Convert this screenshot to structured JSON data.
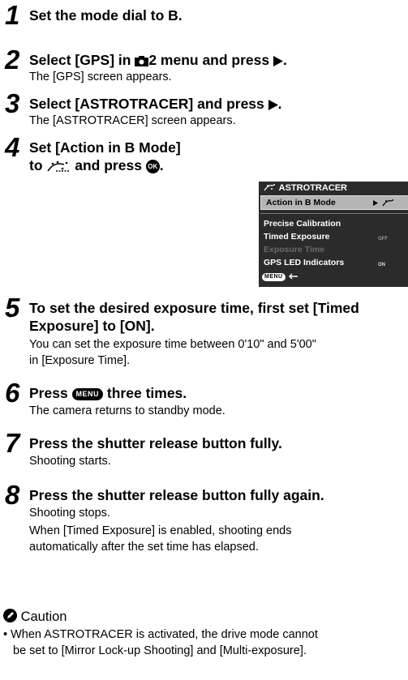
{
  "steps": [
    {
      "num": "1",
      "title": "Set the mode dial to B."
    },
    {
      "num": "2",
      "title_a": "Select [GPS] in ",
      "title_b": "2 menu and press ",
      "title_c": ".",
      "desc": "The [GPS] screen appears."
    },
    {
      "num": "3",
      "title_a": "Select [ASTROTRACER] and press ",
      "title_c": ".",
      "desc": "The [ASTROTRACER] screen appears."
    },
    {
      "num": "4",
      "line1": "Set [Action in B Mode]",
      "line2_a": "to ",
      "line2_b": " and press ",
      "line2_c": "."
    },
    {
      "num": "5",
      "line1": "To set the desired exposure time, first set [Timed",
      "line2": "Exposure] to [ON].",
      "desc1": "You can set the exposure time between 0'10\" and 5'00\"",
      "desc2": "in [Exposure Time]."
    },
    {
      "num": "6",
      "title_a": "Press ",
      "title_b": " three times.",
      "desc": "The camera returns to standby mode."
    },
    {
      "num": "7",
      "title": "Press the shutter release button fully.",
      "desc": "Shooting starts."
    },
    {
      "num": "8",
      "title": "Press the shutter release button fully again.",
      "desc1": "Shooting stops.",
      "desc2": "When [Timed Exposure] is enabled, shooting ends",
      "desc3": "automatically after the set time has elapsed."
    }
  ],
  "badges": {
    "menu": "MENU",
    "ok": "OK"
  },
  "screen": {
    "title": "ASTROTRACER",
    "rows": [
      "Action in B Mode",
      "Precise Calibration",
      "Timed Exposure",
      "Exposure Time",
      "GPS LED Indicators"
    ],
    "values": {
      "timed": "OFF",
      "led": "ON"
    }
  },
  "caution": {
    "title": "Caution",
    "bullet1": "• When ASTROTRACER is activated, the drive mode cannot",
    "bullet2": "be set to [Mirror Lock-up Shooting] and [Multi-exposure]."
  }
}
